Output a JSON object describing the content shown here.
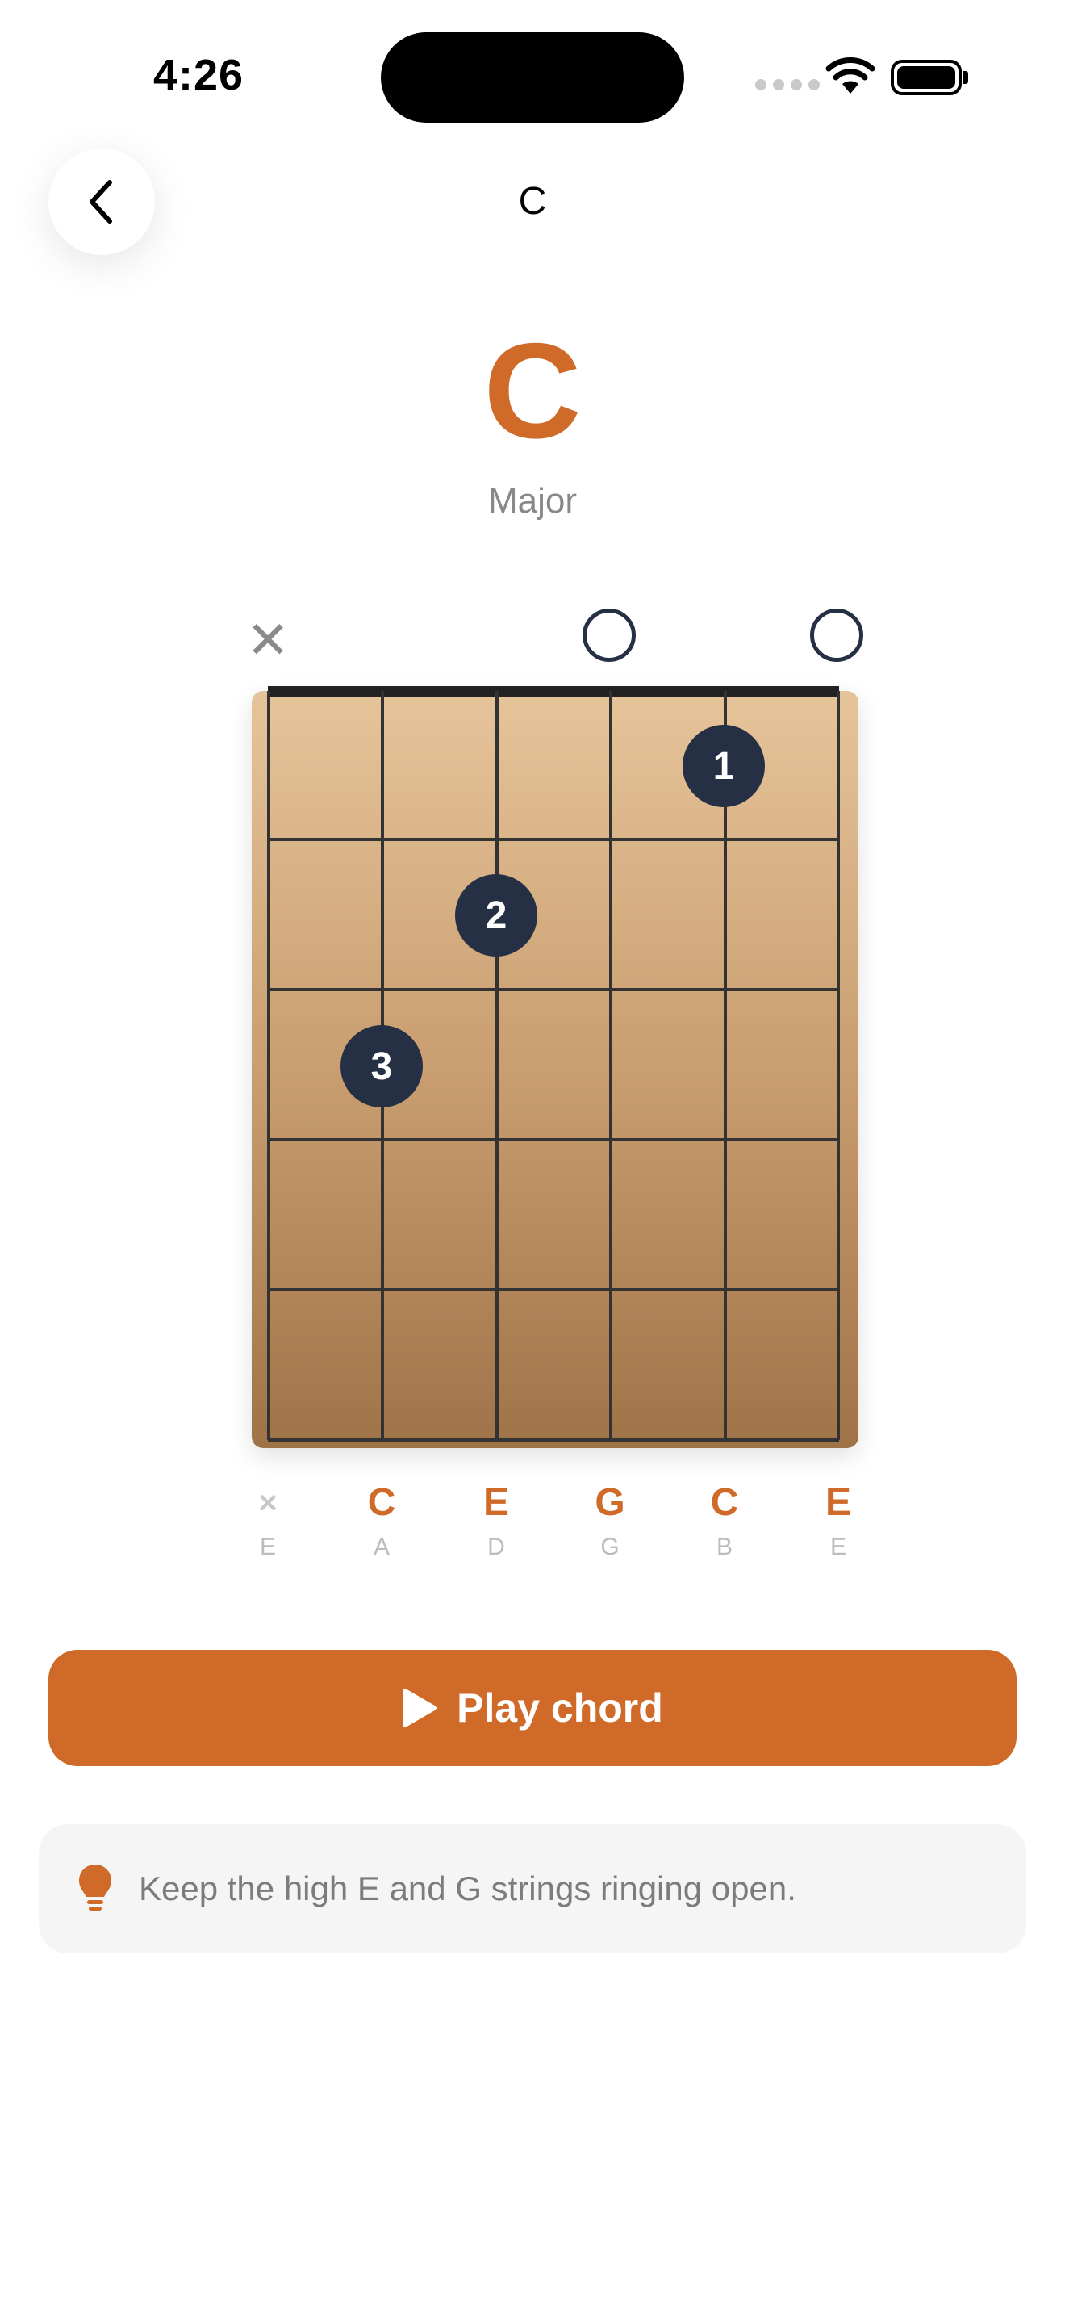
{
  "status_bar": {
    "time": "4:26"
  },
  "nav": {
    "title": "C"
  },
  "chord": {
    "name": "C",
    "quality": "Major",
    "string_markers": [
      "muted",
      "fretted",
      "fretted",
      "open",
      "fretted",
      "open"
    ],
    "fingers": [
      {
        "label": "1",
        "string": 5,
        "fret": 1
      },
      {
        "label": "2",
        "string": 3,
        "fret": 2
      },
      {
        "label": "3",
        "string": 2,
        "fret": 3
      }
    ],
    "notes": [
      "×",
      "C",
      "E",
      "G",
      "C",
      "E"
    ],
    "strings": [
      "E",
      "A",
      "D",
      "G",
      "B",
      "E"
    ],
    "frets_shown": 5,
    "colors": {
      "accent": "#d06a29",
      "dot": "#263044"
    }
  },
  "play_button": {
    "label": "Play chord",
    "icon": "play-icon"
  },
  "tip": {
    "icon": "lightbulb-icon",
    "text": "Keep the high E and G strings ringing open."
  }
}
